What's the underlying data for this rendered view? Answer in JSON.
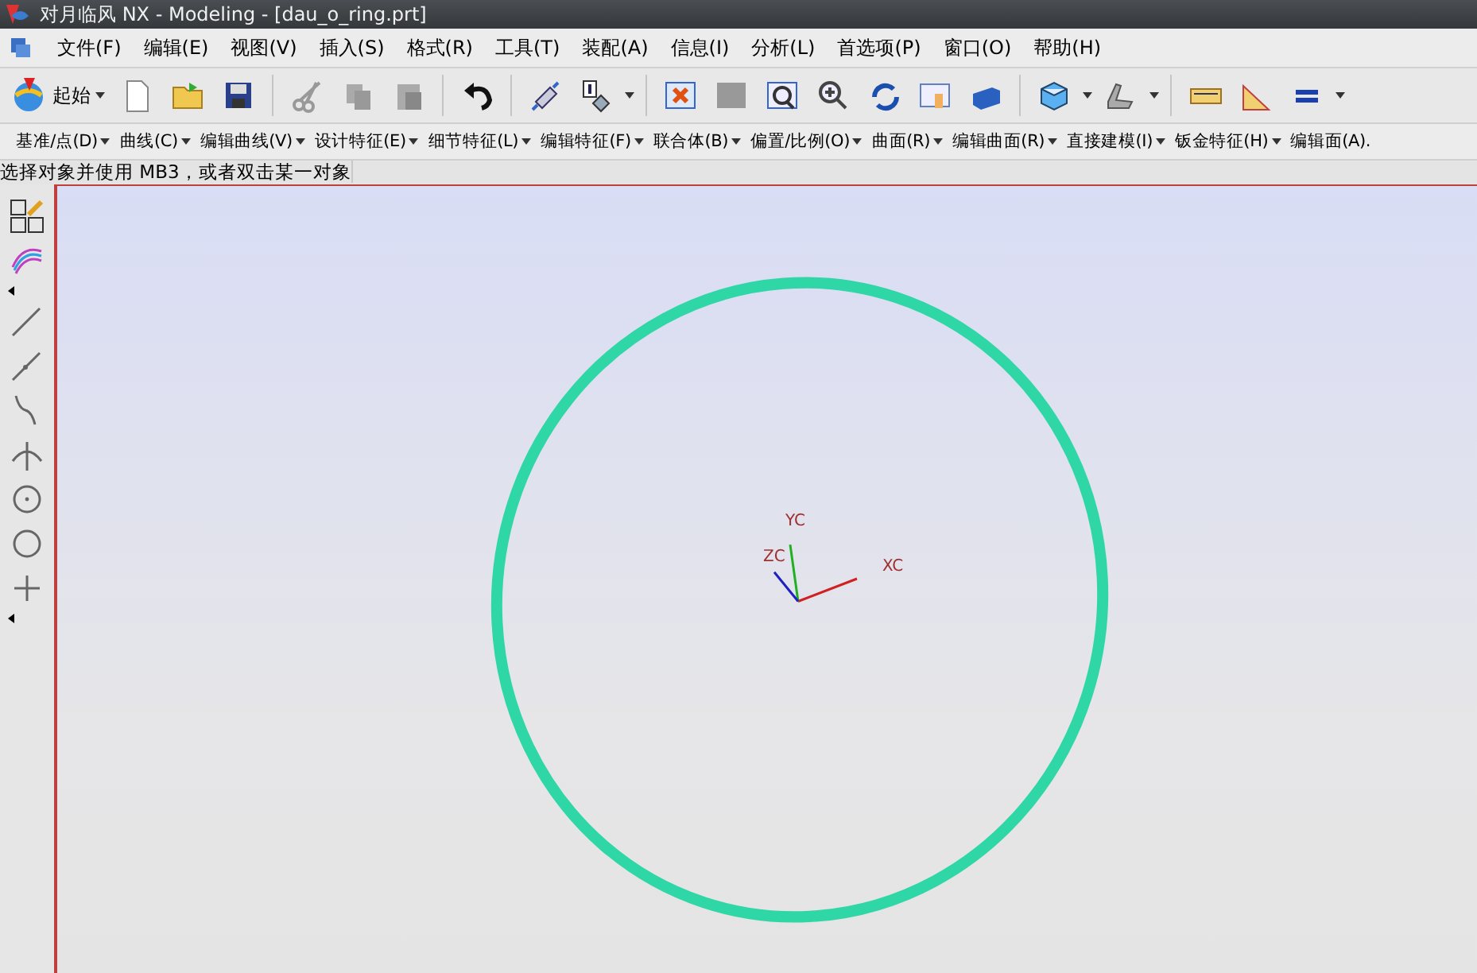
{
  "window": {
    "title": "对月临风 NX - Modeling - [dau_o_ring.prt]"
  },
  "menu": [
    "文件(F)",
    "编辑(E)",
    "视图(V)",
    "插入(S)",
    "格式(R)",
    "工具(T)",
    "装配(A)",
    "信息(I)",
    "分析(L)",
    "首选项(P)",
    "窗口(O)",
    "帮助(H)"
  ],
  "start_button": {
    "label": "起始"
  },
  "feature_toolbar": [
    "基准/点(D)",
    "曲线(C)",
    "编辑曲线(V)",
    "设计特征(E)",
    "细节特征(L)",
    "编辑特征(F)",
    "联合体(B)",
    "偏置/比例(O)",
    "曲面(R)",
    "编辑曲面(R)",
    "直接建模(I)",
    "钣金特征(H)",
    "编辑面(A)."
  ],
  "status_bar": {
    "prompt": "选择对象并使用 MB3，或者双击某一对象"
  },
  "viewport": {
    "axes": [
      "YC",
      "ZC",
      "XC"
    ]
  }
}
